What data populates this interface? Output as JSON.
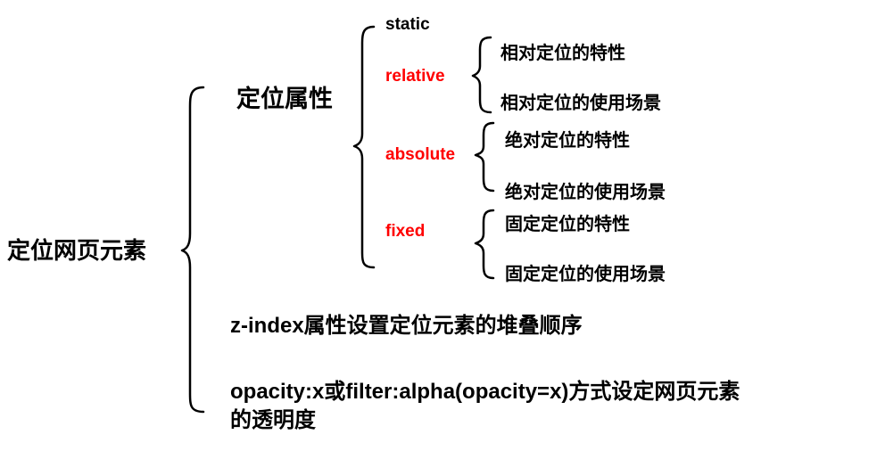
{
  "root": "定位网页元素",
  "positioning_properties": {
    "label": "定位属性",
    "static": "static",
    "relative": {
      "label": "relative",
      "items": [
        "相对定位的特性",
        "相对定位的使用场景"
      ]
    },
    "absolute": {
      "label": "absolute",
      "items": [
        "绝对定位的特性",
        "绝对定位的使用场景"
      ]
    },
    "fixed": {
      "label": "fixed",
      "items": [
        "固定定位的特性",
        "固定定位的使用场景"
      ]
    }
  },
  "zindex": "z-index属性设置定位元素的堆叠顺序",
  "opacity": {
    "line1": "opacity:x或filter:alpha(opacity=x)方式设定网页元素",
    "line2": "的透明度"
  },
  "colors": {
    "text": "#000000",
    "accent": "#ff0000"
  }
}
